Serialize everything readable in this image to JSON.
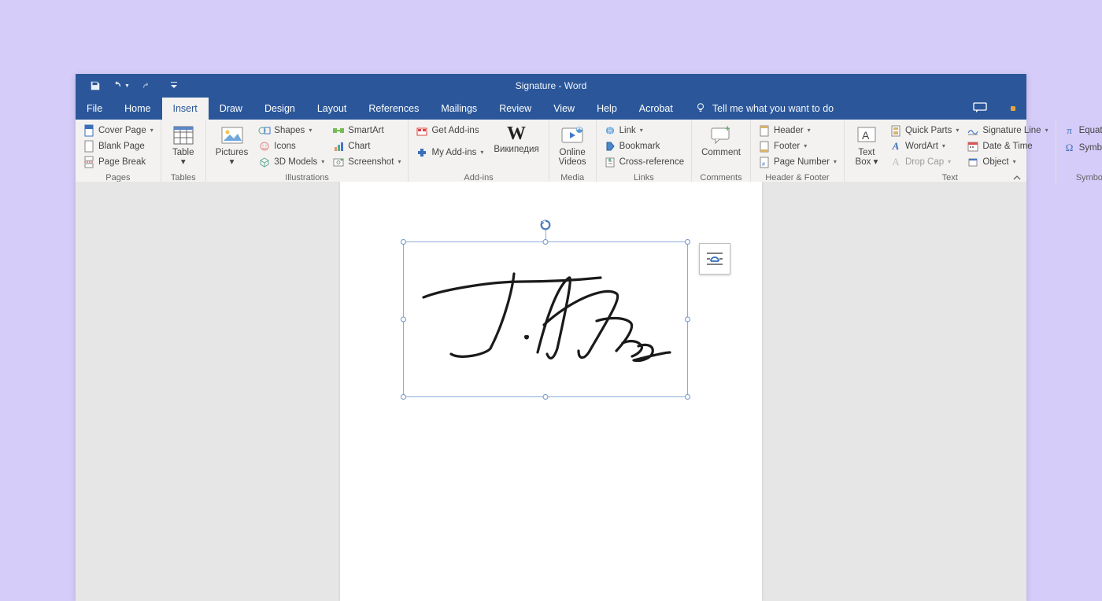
{
  "titlebar": {
    "title": "Signature - Word"
  },
  "menu": {
    "tabs": [
      "File",
      "Home",
      "Insert",
      "Draw",
      "Design",
      "Layout",
      "References",
      "Mailings",
      "Review",
      "View",
      "Help",
      "Acrobat"
    ],
    "active_index": 2,
    "tell_me": "Tell me what you want to do"
  },
  "ribbon": {
    "pages": {
      "label": "Pages",
      "cover_page": "Cover Page",
      "blank_page": "Blank Page",
      "page_break": "Page Break"
    },
    "tables": {
      "label": "Tables",
      "table": "Table"
    },
    "illustrations": {
      "label": "Illustrations",
      "pictures": "Pictures",
      "shapes": "Shapes",
      "icons": "Icons",
      "models3d": "3D Models",
      "smartart": "SmartArt",
      "chart": "Chart",
      "screenshot": "Screenshot"
    },
    "addins": {
      "label": "Add-ins",
      "get_addins": "Get Add-ins",
      "my_addins": "My Add-ins",
      "wikipedia_top": "W",
      "wikipedia_bottom": "Википедия"
    },
    "media": {
      "label": "Media",
      "online_videos_l1": "Online",
      "online_videos_l2": "Videos"
    },
    "links": {
      "label": "Links",
      "link": "Link",
      "bookmark": "Bookmark",
      "cross_ref": "Cross-reference"
    },
    "comments": {
      "label": "Comments",
      "comment": "Comment"
    },
    "header_footer": {
      "label": "Header & Footer",
      "header": "Header",
      "footer": "Footer",
      "page_number": "Page Number"
    },
    "text": {
      "label": "Text",
      "text_box_l1": "Text",
      "text_box_l2": "Box",
      "quick_parts": "Quick Parts",
      "wordart": "WordArt",
      "drop_cap": "Drop Cap",
      "signature_line": "Signature Line",
      "date_time": "Date & Time",
      "object": "Object"
    },
    "symbols": {
      "label": "Symbols",
      "equation": "Equation",
      "symbol": "Symbol"
    }
  }
}
